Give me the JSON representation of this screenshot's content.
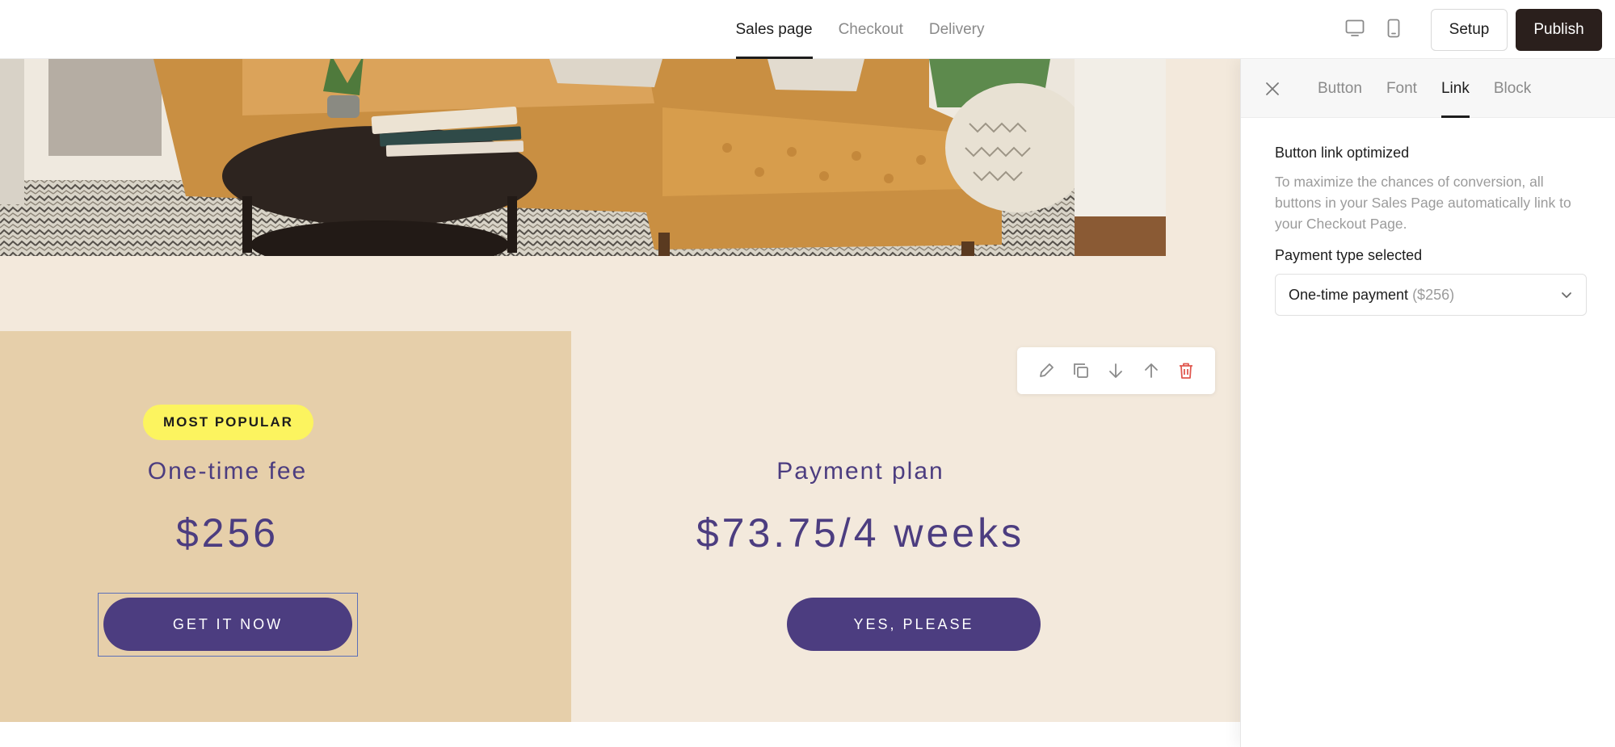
{
  "topbar": {
    "tabs": [
      {
        "label": "Sales page",
        "active": true
      },
      {
        "label": "Checkout",
        "active": false
      },
      {
        "label": "Delivery",
        "active": false
      }
    ],
    "device_icons": [
      "desktop-icon",
      "mobile-icon"
    ],
    "setup_label": "Setup",
    "publish_label": "Publish"
  },
  "hero_image": {
    "icon": "living-room-photo"
  },
  "pricing": {
    "left": {
      "badge": "MOST POPULAR",
      "title": "One-time fee",
      "price": "$256",
      "cta": "GET IT NOW"
    },
    "right": {
      "title": "Payment plan",
      "price": "$73.75/4 weeks",
      "cta": "YES, PLEASE"
    }
  },
  "block_toolbar": {
    "icons": [
      "edit-icon",
      "duplicate-icon",
      "move-down-icon",
      "move-up-icon",
      "delete-icon"
    ]
  },
  "panel": {
    "tabs": [
      {
        "label": "Button",
        "active": false
      },
      {
        "label": "Font",
        "active": false
      },
      {
        "label": "Link",
        "active": true
      },
      {
        "label": "Block",
        "active": false
      }
    ],
    "section_title": "Button link optimized",
    "description": "To maximize the chances of conversion, all buttons in your Sales Page automatically link to your Checkout Page.",
    "payment_label": "Payment type selected",
    "payment_value": "One-time payment",
    "payment_amount": "($256)"
  },
  "colors": {
    "accent_purple": "#4c3d80",
    "badge_yellow": "#fcf45f",
    "left_bg": "#e6cfaa",
    "page_bg": "#f3e9dc",
    "publish_bg": "#2a1f1c",
    "delete_red": "#e0574f"
  }
}
